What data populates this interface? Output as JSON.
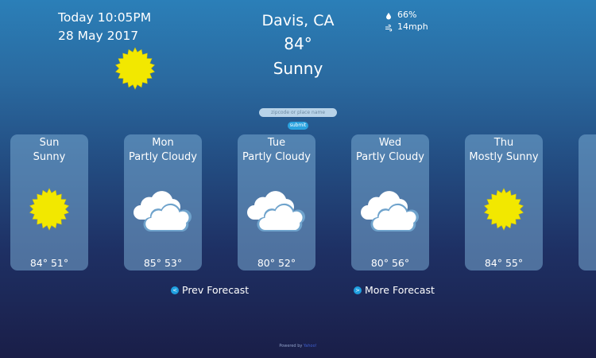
{
  "header": {
    "date_line_1": "Today 10:05PM",
    "date_line_2": "28 May 2017",
    "city": "Davis, CA",
    "temperature": "84°",
    "condition": "Sunny",
    "humidity": "66%",
    "wind": "14mph",
    "icon": "sun-icon"
  },
  "search": {
    "placeholder": "zipcode or place name",
    "submit_label": "submit"
  },
  "forecast": [
    {
      "day": "Sun",
      "condition": "Sunny",
      "temps": "84° 51°",
      "icon": "sun-icon"
    },
    {
      "day": "Mon",
      "condition": "Partly Cloudy",
      "temps": "85° 53°",
      "icon": "cloud-icon"
    },
    {
      "day": "Tue",
      "condition": "Partly Cloudy",
      "temps": "80° 52°",
      "icon": "cloud-icon"
    },
    {
      "day": "Wed",
      "condition": "Partly Cloudy",
      "temps": "80° 56°",
      "icon": "cloud-icon"
    },
    {
      "day": "Thu",
      "condition": "Mostly Sunny",
      "temps": "84° 55°",
      "icon": "sun-icon"
    }
  ],
  "nav": {
    "prev_label": "Prev Forecast",
    "prev_icon": "<",
    "next_label": "More Forecast",
    "next_icon": ">"
  },
  "footer": {
    "powered_by": "Powered by",
    "brand": "Yahoo!"
  },
  "colors": {
    "sun": "#f2e800",
    "card": "rgba(120,170,210,0.55)",
    "accent": "#1e9fe0"
  }
}
